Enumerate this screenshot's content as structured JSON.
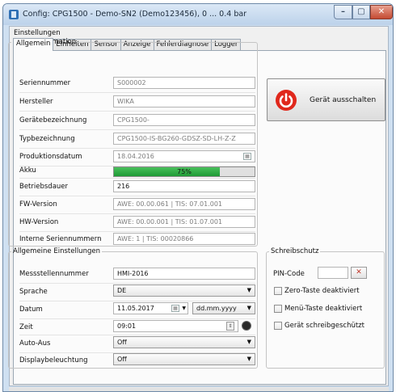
{
  "window": {
    "title": "Config: CPG1500 - Demo-SN2 (Demo123456), 0 ... 0.4 bar"
  },
  "menu": {
    "section": "Einstellungen"
  },
  "tabs": [
    "Allgemein",
    "Einheiten",
    "Sensor",
    "Anzeige",
    "Fehlerdiagnose",
    "Logger"
  ],
  "device_info": {
    "legend": "Geräteinformation",
    "fields": [
      {
        "label": "Seriennummer",
        "value": "S000002"
      },
      {
        "label": "Hersteller",
        "value": "WIKA"
      },
      {
        "label": "Gerätebezeichnung",
        "value": "CPG1500-"
      },
      {
        "label": "Typbezeichnung",
        "value": "CPG1500-IS-BG260-GDSZ-SD-LH-Z-Z"
      },
      {
        "label": "Produktionsdatum",
        "value": "18.04.2016"
      },
      {
        "label": "Akku",
        "value": "75%",
        "level": 0.75
      },
      {
        "label": "Betriebsdauer",
        "value": "216"
      },
      {
        "label": "FW-Version",
        "value": "AWE: 00.00.061 | TIS: 07.01.001"
      },
      {
        "label": "HW-Version",
        "value": "AWE: 00.00.001 | TIS: 01.07.001"
      },
      {
        "label": "Interne Seriennummern",
        "value": "AWE:      1 | TIS: 00020866"
      }
    ]
  },
  "power_button": {
    "label": "Gerät ausschalten",
    "color": "#e0281c"
  },
  "general_settings": {
    "legend": "Allgemeine Einstellungen",
    "messstelle": {
      "label": "Messstellennummer",
      "value": "HMI-2016"
    },
    "sprache": {
      "label": "Sprache",
      "value": "DE"
    },
    "datum": {
      "label": "Datum",
      "value": "11.05.2017",
      "format": "dd.mm.yyyy"
    },
    "zeit": {
      "label": "Zeit",
      "value": "09:01"
    },
    "autoaus": {
      "label": "Auto-Aus",
      "value": "Off"
    },
    "display": {
      "label": "Displaybeleuchtung",
      "value": "Off"
    }
  },
  "write_protect": {
    "legend": "Schreibschutz",
    "pin_label": "PIN-Code",
    "options": [
      "Zero-Taste deaktiviert",
      "Menü-Taste deaktiviert",
      "Gerät schreibgeschützt"
    ]
  }
}
